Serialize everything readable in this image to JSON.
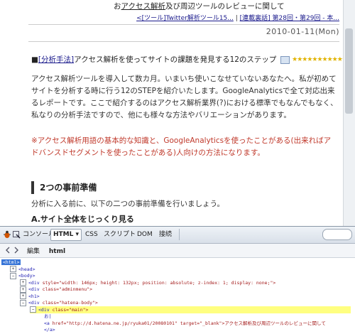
{
  "blog": {
    "title_prefix": "お",
    "title_link": "アクセス解析",
    "title_rest": "及び周辺ツールのレビューに関して",
    "nav_prev": "<[ツール]Twitter解析ツール15...",
    "nav_sep": "|",
    "nav_next": "[連載裏話] 第28回・第29回 - 本...",
    "date": "2010-01-11(Mon)",
    "entry_marker": "■",
    "entry_category": "[分析手法]",
    "entry_title": "アクセス解析を使ってサイトの課題を発見する12のステップ",
    "stars": "★★★★★★★★★★★★★★",
    "paragraph1": "アクセス解析ツールを導入して数カ月。いまいち使いこなせていないあなたへ。私が初めてサイトを分析する時に行う12のSTEPを紹介いたします。GoogleAnalyticsで全て対応出来るレポートです。ここで紹介するのはアクセス解析業界(?)における標準でもなんでもなく、私なりの分析手法ですので、他にも様々な方法やバリエーションがあります。",
    "paragraph2": "※アクセス解析用語の基本的な知識と、GoogleAnalyticsを使ったことがある(出来ればアドバンスドセグメントを使ったことがある)人向けの方法になります。",
    "section_heading": "2つの事前準備",
    "paragraph3": "分析に入る前に、以下の二つの事前準備を行いましょう。",
    "subheading_letter": "A.",
    "subheading_text": "サイト全体をじっくり見る"
  },
  "firebug": {
    "tabs": {
      "console": "コンソール",
      "html": "HTML ▾",
      "css": "CSS",
      "script": "スクリプト",
      "dom": "DOM",
      "net": "接続"
    },
    "breadcrumb_edit": "編集",
    "breadcrumb_node": "html",
    "tree": [
      {
        "expander": "",
        "tag": "<html>",
        "attrs": "",
        "selected": true
      },
      {
        "expander": "+",
        "tag": "<head>",
        "attrs": ""
      },
      {
        "expander": "−",
        "tag": "<body>",
        "attrs": ""
      },
      {
        "expander": "+",
        "tag": "<div",
        "attrs": " style=\"width: 146px; height: 132px; position: absolute; z-index: 1; display: none;\">"
      },
      {
        "expander": "+",
        "tag": "<div",
        "attrs": " class=\"adminmenu\">"
      },
      {
        "expander": "+",
        "tag": "<h1>",
        "attrs": ""
      },
      {
        "expander": "−",
        "tag": "<div",
        "attrs": " class=\"hatena-body\">"
      },
      {
        "expander": "−",
        "tag": "<div",
        "attrs": " class=\"main\">",
        "highlight": true
      },
      {
        "expander": "",
        "tag": "お|",
        "attrs": ""
      },
      {
        "expander": "",
        "tag": "<a",
        "attrs": " href=\"http://d.hatena.ne.jp/ryuka01/20080101\" target=\"_blank\">アクセス解析及び周辺ツールのレビューに関して"
      },
      {
        "expander": "",
        "tag": "</a>",
        "attrs": ""
      }
    ]
  }
}
